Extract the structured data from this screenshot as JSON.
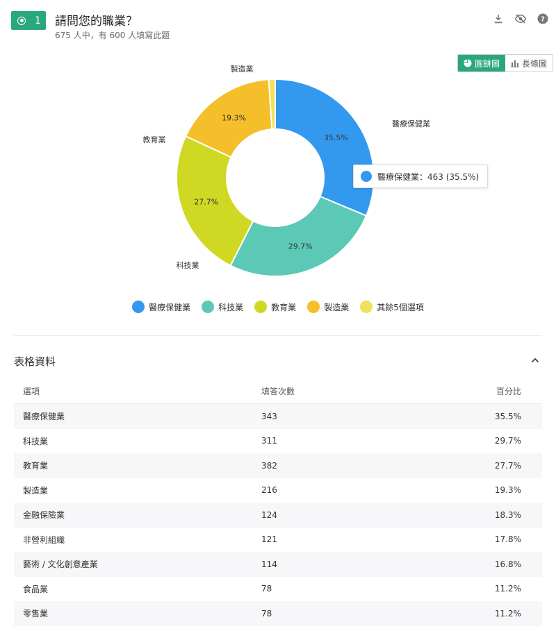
{
  "question": {
    "number": "1",
    "title": "請問您的職業？",
    "subtitle": "675 人中，有 600 人填寫此題"
  },
  "toolbar": {
    "icons": [
      "download-icon",
      "hide-icon",
      "help-icon"
    ]
  },
  "chart_toggle": {
    "pie_label": "圓餅圖",
    "bar_label": "長條圖",
    "active": "pie"
  },
  "chart_data": {
    "type": "pie",
    "donut": true,
    "slices": [
      {
        "label": "醫療保健業",
        "percent": 35.5,
        "percent_label": "35.5%",
        "color": "#3399ef"
      },
      {
        "label": "科技業",
        "percent": 29.7,
        "percent_label": "29.7%",
        "color": "#5cc8b6"
      },
      {
        "label": "教育業",
        "percent": 27.7,
        "percent_label": "27.7%",
        "color": "#cfd923"
      },
      {
        "label": "製造業",
        "percent": 19.3,
        "percent_label": "19.3%",
        "color": "#f5bf2b"
      },
      {
        "label": "",
        "percent": 1.2,
        "percent_label": "",
        "color": "#f0e15a"
      }
    ],
    "legend": [
      {
        "label": "醫療保健業",
        "color": "#3399ef"
      },
      {
        "label": "科技業",
        "color": "#5cc8b6"
      },
      {
        "label": "教育業",
        "color": "#cfd923"
      },
      {
        "label": "製造業",
        "color": "#f5bf2b"
      },
      {
        "label": "其餘5個選項",
        "color": "#f0e15a"
      }
    ],
    "tooltip": "醫療保健業：463 (35.5%)"
  },
  "table_section": {
    "title": "表格資料",
    "columns": [
      "選項",
      "填答次數",
      "百分比"
    ],
    "rows": [
      [
        "醫療保健業",
        "343",
        "35.5%"
      ],
      [
        "科技業",
        "311",
        "29.7%"
      ],
      [
        "教育業",
        "382",
        "27.7%"
      ],
      [
        "製造業",
        "216",
        "19.3%"
      ],
      [
        "金融保險業",
        "124",
        "18.3%"
      ],
      [
        "非營利組織",
        "121",
        "17.8%"
      ],
      [
        "藝術 / 文化創意產業",
        "114",
        "16.8%"
      ],
      [
        "食品業",
        "78",
        "11.2%"
      ],
      [
        "零售業",
        "78",
        "11.2%"
      ]
    ]
  },
  "colors": {
    "accent": "#2aa77f"
  }
}
